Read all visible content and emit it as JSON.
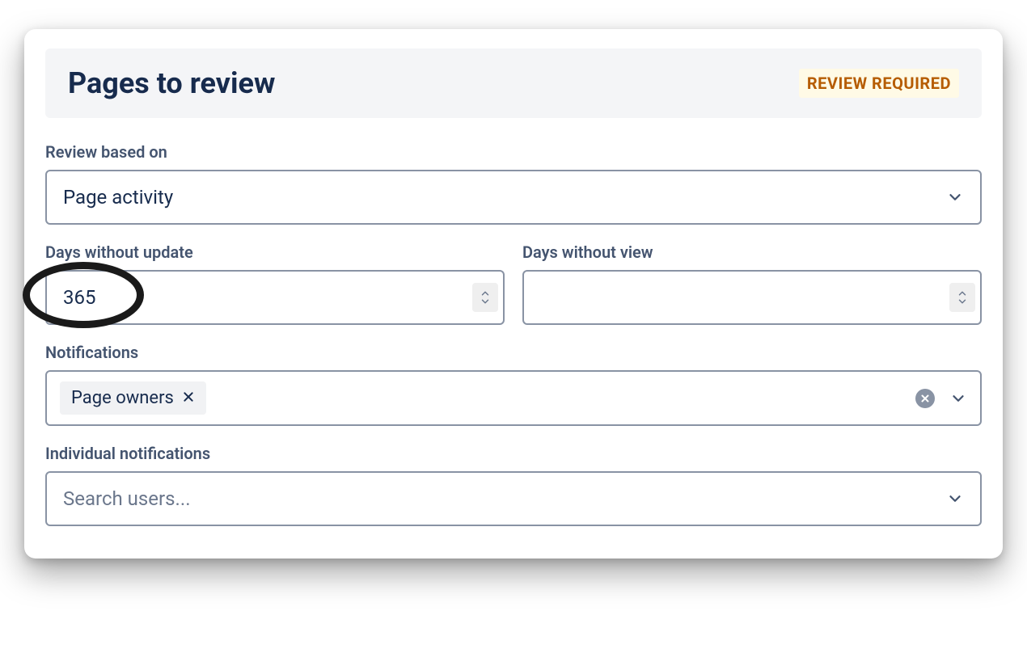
{
  "header": {
    "title": "Pages to review",
    "badge": "REVIEW REQUIRED"
  },
  "fields": {
    "review_based_on": {
      "label": "Review based on",
      "value": "Page activity"
    },
    "days_without_update": {
      "label": "Days without update",
      "value": "365"
    },
    "days_without_view": {
      "label": "Days without view",
      "value": ""
    },
    "notifications": {
      "label": "Notifications",
      "tags": [
        "Page owners"
      ]
    },
    "individual_notifications": {
      "label": "Individual notifications",
      "placeholder": "Search users..."
    }
  }
}
